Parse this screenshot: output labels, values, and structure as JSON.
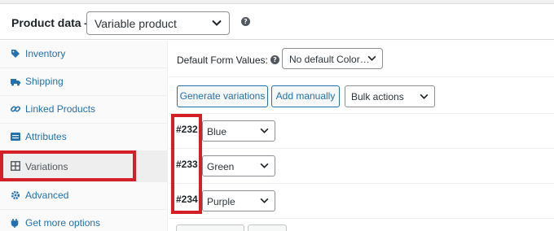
{
  "header": {
    "title": "Product data —",
    "product_type": "Variable product"
  },
  "sidebar": {
    "items": [
      {
        "label": "Inventory",
        "icon": "tag-icon"
      },
      {
        "label": "Shipping",
        "icon": "truck-icon"
      },
      {
        "label": "Linked Products",
        "icon": "link-icon"
      },
      {
        "label": "Attributes",
        "icon": "list-icon"
      },
      {
        "label": "Variations",
        "icon": "grid-icon",
        "active": true
      },
      {
        "label": "Advanced",
        "icon": "gear-icon"
      },
      {
        "label": "Get more options",
        "icon": "plugin-icon"
      }
    ]
  },
  "main": {
    "default_form_label": "Default Form Values:",
    "default_form_value": "No default Color…",
    "buttons": {
      "generate": "Generate variations",
      "add_manually": "Add manually"
    },
    "bulk_actions": "Bulk actions",
    "variations": [
      {
        "id": "#232",
        "value": "Blue"
      },
      {
        "id": "#233",
        "value": "Green"
      },
      {
        "id": "#234",
        "value": "Purple"
      }
    ]
  },
  "colors": {
    "link": "#2271b1",
    "highlight": "#d41f26"
  }
}
